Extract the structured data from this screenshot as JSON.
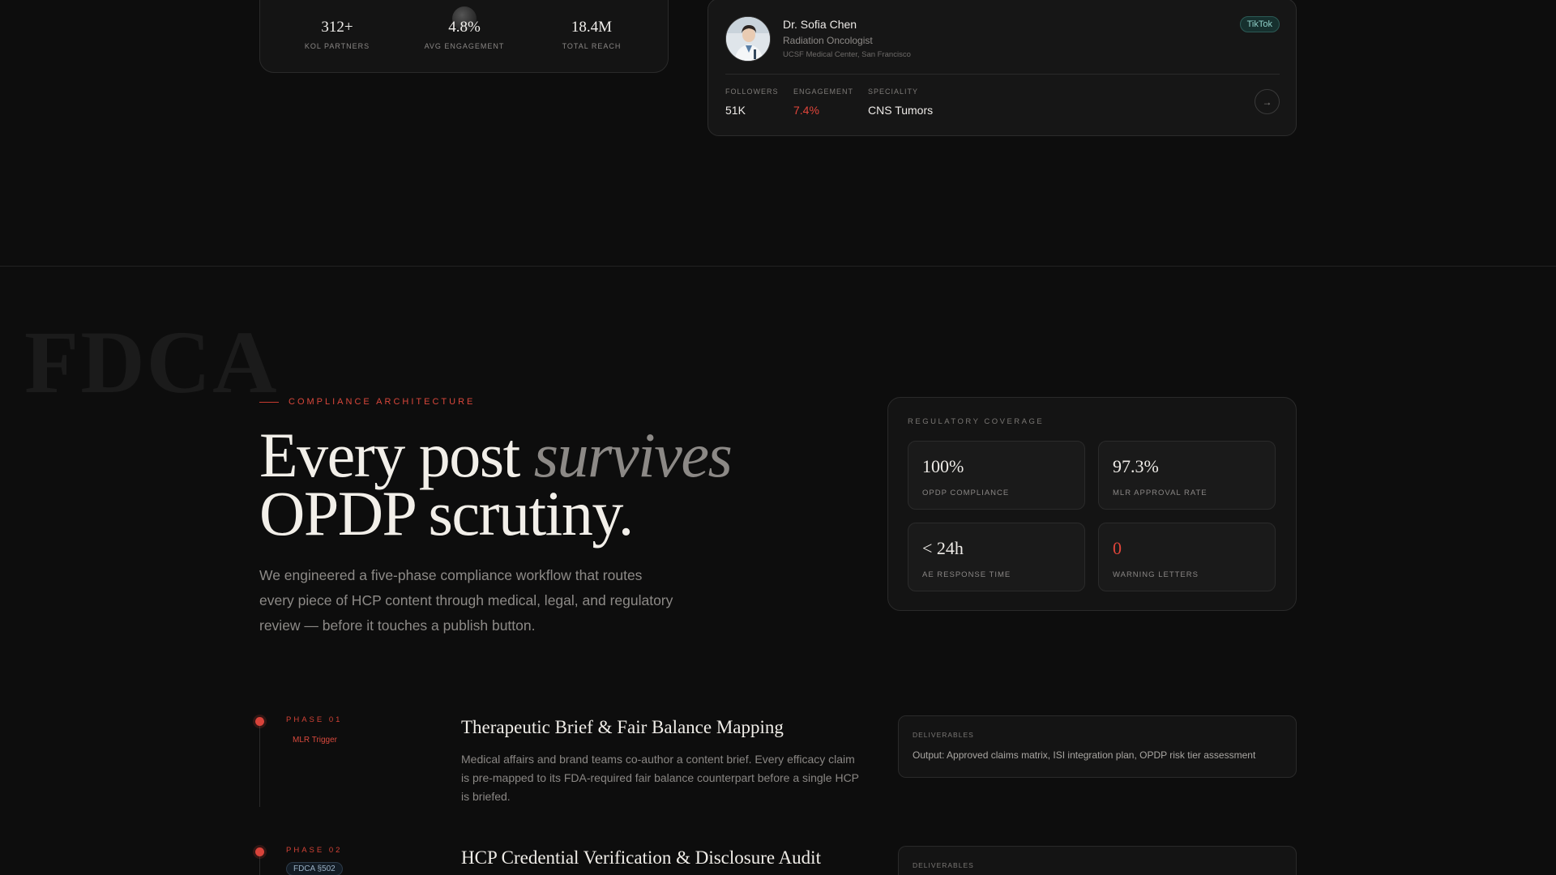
{
  "stats_card": {
    "stats": [
      {
        "value": "312+",
        "label": "KOL PARTNERS"
      },
      {
        "value": "4.8%",
        "label": "AVG ENGAGEMENT"
      },
      {
        "value": "18.4M",
        "label": "TOTAL REACH"
      }
    ]
  },
  "profile": {
    "name": "Dr. Sofia Chen",
    "role": "Radiation Oncologist",
    "org": "UCSF Medical Center, San Francisco",
    "platform": "TikTok",
    "metrics": [
      {
        "key": "FOLLOWERS",
        "value": "51K"
      },
      {
        "key": "ENGAGEMENT",
        "value": "7.4%"
      },
      {
        "key": "SPECIALITY",
        "value": "CNS Tumors"
      }
    ],
    "arrow": "→",
    "accent_color": "#e0453a"
  },
  "compliance": {
    "watermark": "FDCA",
    "eyebrow": "COMPLIANCE ARCHITECTURE",
    "headline_part1": "Every post ",
    "headline_italic": "survives",
    "headline_line2": "OPDP scrutiny.",
    "lede": "We engineered a five-phase compliance workflow that routes every piece of HCP content through medical, legal, and regulatory review — before it touches a publish button."
  },
  "regulatory": {
    "title": "REGULATORY COVERAGE",
    "tiles": [
      {
        "value": "100%",
        "label": "OPDP COMPLIANCE"
      },
      {
        "value": "97.3%",
        "label": "MLR APPROVAL RATE"
      },
      {
        "value": "< 24h",
        "label": "AE RESPONSE TIME"
      },
      {
        "value": "0",
        "label": "WARNING LETTERS"
      }
    ]
  },
  "phases": [
    {
      "label": "PHASE 01",
      "tag": "MLR Trigger",
      "title": "Therapeutic Brief & Fair Balance Mapping",
      "description": "Medical affairs and brand teams co-author a content brief. Every efficacy claim is pre-mapped to its FDA-required fair balance counterpart before a single HCP is briefed.",
      "deliverables_label": "DELIVERABLES",
      "deliverables": "Output: Approved claims matrix, ISI integration plan, OPDP risk tier assessment"
    },
    {
      "label": "PHASE 02",
      "tag": "FDCA §502",
      "title": "HCP Credential Verification & Disclosure Audit",
      "deliverables_label": "DELIVERABLES"
    }
  ]
}
